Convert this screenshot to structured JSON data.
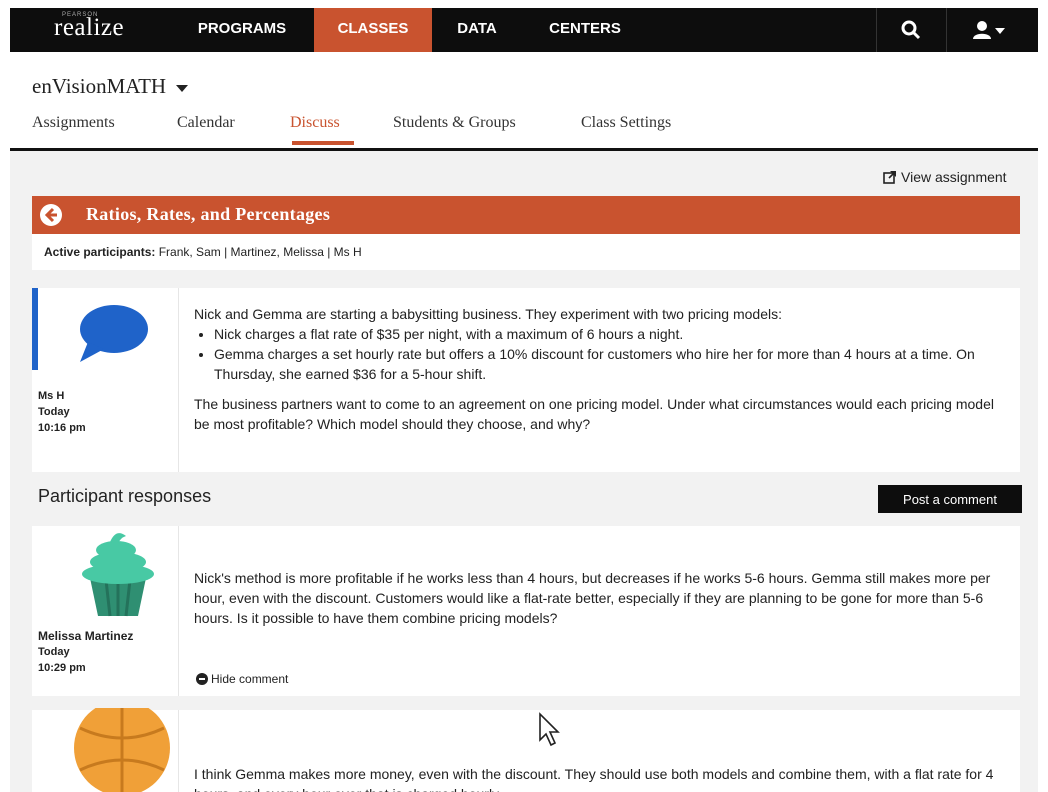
{
  "nav": {
    "brand": "realize",
    "brand_small": "PEARSON",
    "items": [
      {
        "label": "PROGRAMS",
        "active": false
      },
      {
        "label": "CLASSES",
        "active": true
      },
      {
        "label": "DATA",
        "active": false
      },
      {
        "label": "CENTERS",
        "active": false
      }
    ],
    "search_icon": "search-icon",
    "user_icon": "user-icon"
  },
  "class_header": {
    "title": "enVisionMATH",
    "tabs": [
      {
        "label": "Assignments",
        "active": false
      },
      {
        "label": "Calendar",
        "active": false
      },
      {
        "label": "Discuss",
        "active": true
      },
      {
        "label": "Students & Groups",
        "active": false
      },
      {
        "label": "Class Settings",
        "active": false
      }
    ]
  },
  "discussion": {
    "view_assignment": "View assignment",
    "title": "Ratios, Rates, and Percentages",
    "participants_label": "Active participants:",
    "participants": "Frank, Sam | Martinez, Melissa | Ms H",
    "accent_color": "#c9532f",
    "post": {
      "author": "Ms H",
      "day": "Today",
      "time": "10:16 pm",
      "avatar": "speech-bubble-icon",
      "intro": "Nick and Gemma are starting a babysitting business. They experiment with two pricing models:",
      "bullets": [
        "Nick charges a flat rate of $35 per night, with a maximum of 6 hours a night.",
        "Gemma charges a set hourly rate but offers a 10% discount for customers who hire her for more than 4 hours at a time. On Thursday, she earned $36 for a 5-hour shift."
      ],
      "question": "The business partners want to come to an agreement on one pricing model. Under what circumstances would each pricing model be most profitable? Which model should they choose, and why?"
    }
  },
  "responses": {
    "heading": "Participant responses",
    "post_button": "Post a comment",
    "items": [
      {
        "author": "Melissa Martinez",
        "day": "Today",
        "time": "10:29 pm",
        "avatar": "cupcake-icon",
        "text": "Nick's method is more profitable if he works less than 4 hours, but decreases  if he works 5-6  hours. Gemma still makes more per hour, even with the discount. Customers would like a flat-rate better, especially if they are planning to be gone for more than 5-6 hours. Is it possible to have them combine pricing models?",
        "hide_label": "Hide comment"
      },
      {
        "avatar": "basketball-icon",
        "text": "I think Gemma makes more money, even with the discount. They should use both models and combine them, with a flat rate for 4 hours, and every hour over that is charged hourly."
      }
    ]
  }
}
